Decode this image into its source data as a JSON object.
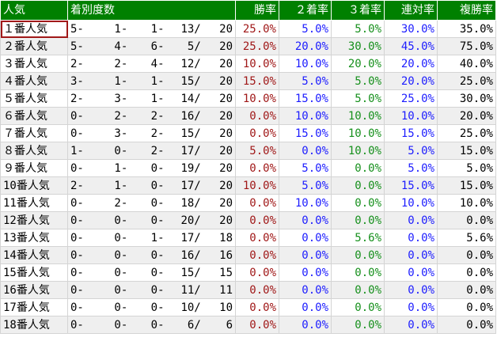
{
  "header": {
    "popularity": "人気",
    "record": "着別度数",
    "win_rate": "勝率",
    "second_rate": "２着率",
    "third_rate": "３着率",
    "quinella_rate": "連対率",
    "place_rate": "複勝率"
  },
  "colors": {
    "header_bg": "#008000",
    "win_rate": "#a01818",
    "second_rate": "#1c1cff",
    "third_rate": "#16901c",
    "quinella_rate": "#1c1cff",
    "place_rate": "#000000"
  },
  "rows": [
    {
      "pop": "１番人気",
      "w": "5-",
      "s": "1-",
      "t": "1-",
      "o": "13/",
      "n": "20",
      "win": "25.0%",
      "p2": "5.0%",
      "p3": "5.0%",
      "ren": "30.0%",
      "fuku": "35.0%"
    },
    {
      "pop": "２番人気",
      "w": "5-",
      "s": "4-",
      "t": "6-",
      "o": "5/",
      "n": "20",
      "win": "25.0%",
      "p2": "20.0%",
      "p3": "30.0%",
      "ren": "45.0%",
      "fuku": "75.0%"
    },
    {
      "pop": "３番人気",
      "w": "2-",
      "s": "2-",
      "t": "4-",
      "o": "12/",
      "n": "20",
      "win": "10.0%",
      "p2": "10.0%",
      "p3": "20.0%",
      "ren": "20.0%",
      "fuku": "40.0%"
    },
    {
      "pop": "４番人気",
      "w": "3-",
      "s": "1-",
      "t": "1-",
      "o": "15/",
      "n": "20",
      "win": "15.0%",
      "p2": "5.0%",
      "p3": "5.0%",
      "ren": "20.0%",
      "fuku": "25.0%"
    },
    {
      "pop": "５番人気",
      "w": "2-",
      "s": "3-",
      "t": "1-",
      "o": "14/",
      "n": "20",
      "win": "10.0%",
      "p2": "15.0%",
      "p3": "5.0%",
      "ren": "25.0%",
      "fuku": "30.0%"
    },
    {
      "pop": "６番人気",
      "w": "0-",
      "s": "2-",
      "t": "2-",
      "o": "16/",
      "n": "20",
      "win": "0.0%",
      "p2": "10.0%",
      "p3": "10.0%",
      "ren": "10.0%",
      "fuku": "20.0%"
    },
    {
      "pop": "７番人気",
      "w": "0-",
      "s": "3-",
      "t": "2-",
      "o": "15/",
      "n": "20",
      "win": "0.0%",
      "p2": "15.0%",
      "p3": "10.0%",
      "ren": "15.0%",
      "fuku": "25.0%"
    },
    {
      "pop": "８番人気",
      "w": "1-",
      "s": "0-",
      "t": "2-",
      "o": "17/",
      "n": "20",
      "win": "5.0%",
      "p2": "0.0%",
      "p3": "10.0%",
      "ren": "5.0%",
      "fuku": "15.0%"
    },
    {
      "pop": "９番人気",
      "w": "0-",
      "s": "1-",
      "t": "0-",
      "o": "19/",
      "n": "20",
      "win": "0.0%",
      "p2": "5.0%",
      "p3": "0.0%",
      "ren": "5.0%",
      "fuku": "5.0%"
    },
    {
      "pop": "10番人気",
      "w": "2-",
      "s": "1-",
      "t": "0-",
      "o": "17/",
      "n": "20",
      "win": "10.0%",
      "p2": "5.0%",
      "p3": "0.0%",
      "ren": "15.0%",
      "fuku": "15.0%"
    },
    {
      "pop": "11番人気",
      "w": "0-",
      "s": "2-",
      "t": "0-",
      "o": "18/",
      "n": "20",
      "win": "0.0%",
      "p2": "10.0%",
      "p3": "0.0%",
      "ren": "10.0%",
      "fuku": "10.0%"
    },
    {
      "pop": "12番人気",
      "w": "0-",
      "s": "0-",
      "t": "0-",
      "o": "20/",
      "n": "20",
      "win": "0.0%",
      "p2": "0.0%",
      "p3": "0.0%",
      "ren": "0.0%",
      "fuku": "0.0%"
    },
    {
      "pop": "13番人気",
      "w": "0-",
      "s": "0-",
      "t": "1-",
      "o": "17/",
      "n": "18",
      "win": "0.0%",
      "p2": "0.0%",
      "p3": "5.6%",
      "ren": "0.0%",
      "fuku": "5.6%"
    },
    {
      "pop": "14番人気",
      "w": "0-",
      "s": "0-",
      "t": "0-",
      "o": "16/",
      "n": "16",
      "win": "0.0%",
      "p2": "0.0%",
      "p3": "0.0%",
      "ren": "0.0%",
      "fuku": "0.0%"
    },
    {
      "pop": "15番人気",
      "w": "0-",
      "s": "0-",
      "t": "0-",
      "o": "15/",
      "n": "15",
      "win": "0.0%",
      "p2": "0.0%",
      "p3": "0.0%",
      "ren": "0.0%",
      "fuku": "0.0%"
    },
    {
      "pop": "16番人気",
      "w": "0-",
      "s": "0-",
      "t": "0-",
      "o": "11/",
      "n": "11",
      "win": "0.0%",
      "p2": "0.0%",
      "p3": "0.0%",
      "ren": "0.0%",
      "fuku": "0.0%"
    },
    {
      "pop": "17番人気",
      "w": "0-",
      "s": "0-",
      "t": "0-",
      "o": "10/",
      "n": "10",
      "win": "0.0%",
      "p2": "0.0%",
      "p3": "0.0%",
      "ren": "0.0%",
      "fuku": "0.0%"
    },
    {
      "pop": "18番人気",
      "w": "0-",
      "s": "0-",
      "t": "0-",
      "o": "6/",
      "n": "6",
      "win": "0.0%",
      "p2": "0.0%",
      "p3": "0.0%",
      "ren": "0.0%",
      "fuku": "0.0%"
    }
  ]
}
